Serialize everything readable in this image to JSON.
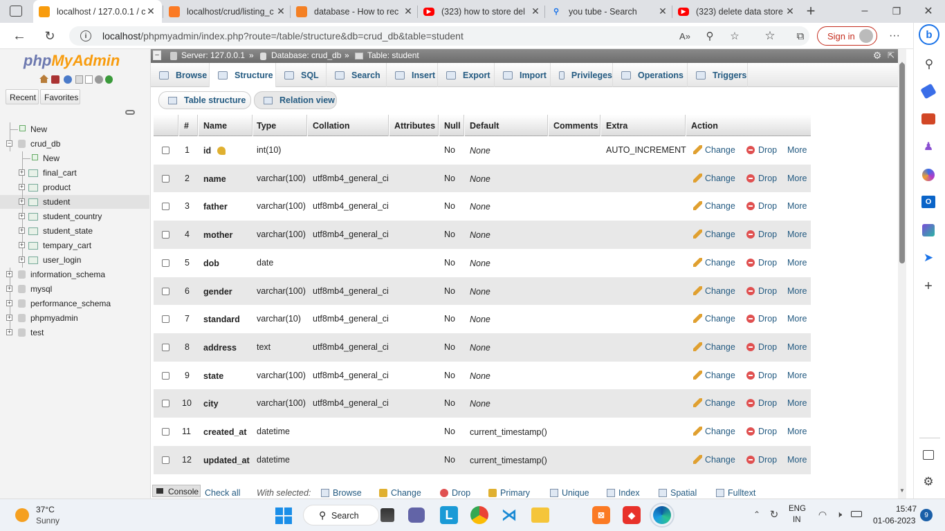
{
  "browser": {
    "tabs": [
      {
        "title": "localhost / 127.0.0.1 / c",
        "icon": "phpmyadmin-icon"
      },
      {
        "title": "localhost/crud/listing_c",
        "icon": "xampp-icon"
      },
      {
        "title": "database - How to rec",
        "icon": "stackoverflow-icon"
      },
      {
        "title": "(323) how to store del",
        "icon": "youtube-icon"
      },
      {
        "title": "you tube - Search",
        "icon": "search-icon"
      },
      {
        "title": "(323) delete data store",
        "icon": "youtube-icon"
      }
    ],
    "url_host": "localhost",
    "url_path": "/phpmyadmin/index.php?route=/table/structure&db=crud_db&table=student",
    "sign_in": "Sign in"
  },
  "sidebar": {
    "logo_php": "php",
    "logo_my": "MyAdmin",
    "recent": "Recent",
    "favorites": "Favorites",
    "tree": [
      {
        "label": "New",
        "level": 0
      },
      {
        "label": "crud_db",
        "level": 0
      },
      {
        "label": "New",
        "level": 1
      },
      {
        "label": "final_cart",
        "level": 1
      },
      {
        "label": "product",
        "level": 1
      },
      {
        "label": "student",
        "level": 1
      },
      {
        "label": "student_country",
        "level": 1
      },
      {
        "label": "student_state",
        "level": 1
      },
      {
        "label": "tempary_cart",
        "level": 1
      },
      {
        "label": "user_login",
        "level": 1
      },
      {
        "label": "information_schema",
        "level": 0
      },
      {
        "label": "mysql",
        "level": 0
      },
      {
        "label": "performance_schema",
        "level": 0
      },
      {
        "label": "phpmyadmin",
        "level": 0
      },
      {
        "label": "test",
        "level": 0
      }
    ]
  },
  "breadcrumb": {
    "server": "Server: 127.0.0.1",
    "database": "Database: crud_db",
    "table": "Table: student"
  },
  "menu": [
    "Browse",
    "Structure",
    "SQL",
    "Search",
    "Insert",
    "Export",
    "Import",
    "Privileges",
    "Operations",
    "Triggers"
  ],
  "subtabs": [
    "Table structure",
    "Relation view"
  ],
  "columns": [
    "#",
    "Name",
    "Type",
    "Collation",
    "Attributes",
    "Null",
    "Default",
    "Comments",
    "Extra",
    "Action"
  ],
  "rows": [
    {
      "n": "1",
      "name": "id",
      "type": "int(10)",
      "collation": "",
      "null": "No",
      "default": "None",
      "extra": "AUTO_INCREMENT"
    },
    {
      "n": "2",
      "name": "name",
      "type": "varchar(100)",
      "collation": "utf8mb4_general_ci",
      "null": "No",
      "default": "None",
      "extra": ""
    },
    {
      "n": "3",
      "name": "father",
      "type": "varchar(100)",
      "collation": "utf8mb4_general_ci",
      "null": "No",
      "default": "None",
      "extra": ""
    },
    {
      "n": "4",
      "name": "mother",
      "type": "varchar(100)",
      "collation": "utf8mb4_general_ci",
      "null": "No",
      "default": "None",
      "extra": ""
    },
    {
      "n": "5",
      "name": "dob",
      "type": "date",
      "collation": "",
      "null": "No",
      "default": "None",
      "extra": ""
    },
    {
      "n": "6",
      "name": "gender",
      "type": "varchar(100)",
      "collation": "utf8mb4_general_ci",
      "null": "No",
      "default": "None",
      "extra": ""
    },
    {
      "n": "7",
      "name": "standard",
      "type": "varchar(10)",
      "collation": "utf8mb4_general_ci",
      "null": "No",
      "default": "None",
      "extra": ""
    },
    {
      "n": "8",
      "name": "address",
      "type": "text",
      "collation": "utf8mb4_general_ci",
      "null": "No",
      "default": "None",
      "extra": ""
    },
    {
      "n": "9",
      "name": "state",
      "type": "varchar(100)",
      "collation": "utf8mb4_general_ci",
      "null": "No",
      "default": "None",
      "extra": ""
    },
    {
      "n": "10",
      "name": "city",
      "type": "varchar(100)",
      "collation": "utf8mb4_general_ci",
      "null": "No",
      "default": "None",
      "extra": ""
    },
    {
      "n": "11",
      "name": "created_at",
      "type": "datetime",
      "collation": "",
      "null": "No",
      "default": "current_timestamp()",
      "extra": ""
    },
    {
      "n": "12",
      "name": "updated_at",
      "type": "datetime",
      "collation": "",
      "null": "No",
      "default": "current_timestamp()",
      "extra": ""
    }
  ],
  "actions": {
    "change": "Change",
    "drop": "Drop",
    "more": "More"
  },
  "bottom": {
    "console": "Console",
    "check_all": "Check all",
    "with_selected": "With selected:",
    "items": [
      "Browse",
      "Change",
      "Drop",
      "Primary",
      "Unique",
      "Index",
      "Spatial",
      "Fulltext"
    ]
  },
  "taskbar": {
    "temp": "37°C",
    "weather": "Sunny",
    "search": "Search",
    "lang1": "ENG",
    "lang2": "IN",
    "time": "15:47",
    "date": "01-06-2023",
    "badge": "9"
  }
}
